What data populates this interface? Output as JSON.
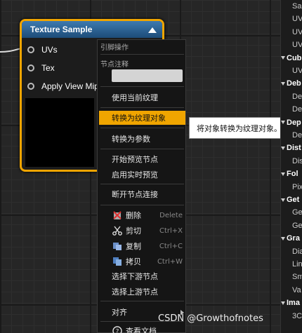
{
  "node": {
    "title": "Texture Sample",
    "pins": [
      "UVs",
      "Tex",
      "Apply View Mip"
    ]
  },
  "context_menu": {
    "section_pin_actions": "引脚操作",
    "section_node_comment": "节点注释",
    "items": {
      "use_current_texture": "使用当前纹理",
      "convert_to_texture_object": "转换为纹理对象",
      "convert_to_parameter": "转换为参数",
      "start_preview_node": "开始预览节点",
      "enable_realtime_preview": "启用实时预览",
      "break_node_links": "断开节点连接",
      "delete": "删除",
      "delete_shortcut": "Delete",
      "cut": "剪切",
      "cut_shortcut": "Ctrl+X",
      "copy": "复制",
      "copy_shortcut": "Ctrl+C",
      "duplicate": "拷贝",
      "duplicate_shortcut": "Ctrl+W",
      "select_downstream": "选择下游节点",
      "select_upstream": "选择上游节点",
      "align": "对齐",
      "view_docs": "查看文档"
    }
  },
  "tooltip": {
    "text": "将对象转换为纹理对象。"
  },
  "right_panel": {
    "rows": [
      {
        "type": "item",
        "label": "Sa"
      },
      {
        "type": "item",
        "label": "UV"
      },
      {
        "type": "item",
        "label": "UV"
      },
      {
        "type": "item",
        "label": "UV"
      },
      {
        "type": "cat",
        "label": "Cub"
      },
      {
        "type": "item",
        "label": "UV"
      },
      {
        "type": "cat",
        "label": "Deb"
      },
      {
        "type": "item",
        "label": "De"
      },
      {
        "type": "item",
        "label": "De"
      },
      {
        "type": "cat",
        "label": "Dep"
      },
      {
        "type": "item",
        "label": "De"
      },
      {
        "type": "cat",
        "label": "Dist"
      },
      {
        "type": "item",
        "label": "Dis"
      },
      {
        "type": "cat",
        "label": "Fol"
      },
      {
        "type": "item",
        "label": "Pix"
      },
      {
        "type": "cat",
        "label": "Get"
      },
      {
        "type": "item",
        "label": "Ge"
      },
      {
        "type": "item",
        "label": "Ge"
      },
      {
        "type": "cat",
        "label": "Gra"
      },
      {
        "type": "item",
        "label": "Dia"
      },
      {
        "type": "item",
        "label": "Lin"
      },
      {
        "type": "item",
        "label": "Sm"
      },
      {
        "type": "item",
        "label": "Va"
      },
      {
        "type": "cat",
        "label": "Ima"
      },
      {
        "type": "item",
        "label": "3C"
      }
    ]
  },
  "watermark": "CSDN @Growthofnotes",
  "colors": {
    "node_border": "#f0a500",
    "highlight": "#f0a500",
    "node_header": "#2a5f8f"
  }
}
